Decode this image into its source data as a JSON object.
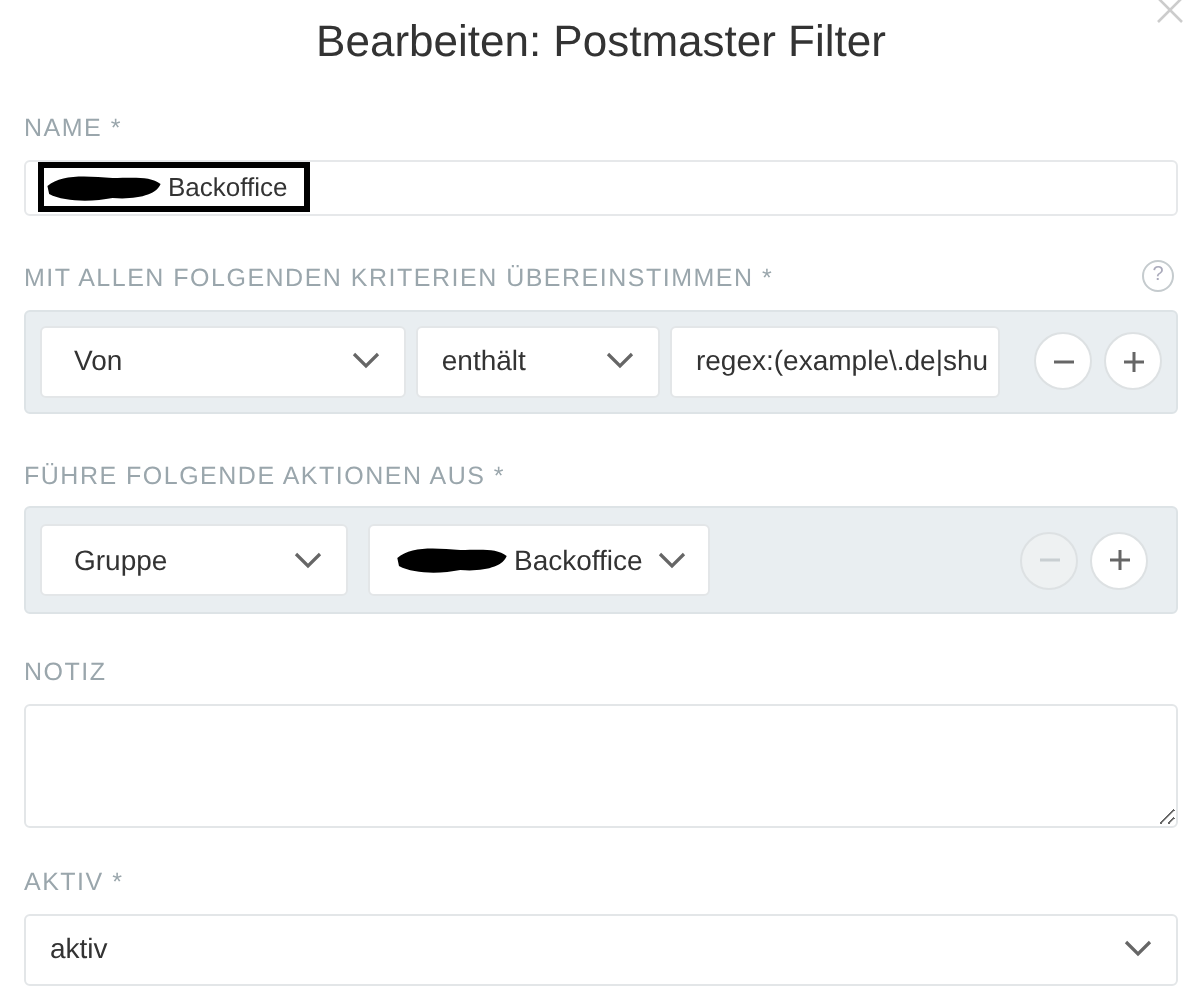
{
  "dialog": {
    "title": "Bearbeiten: Postmaster Filter"
  },
  "name_field": {
    "label": "NAME *",
    "value": "Backoffice",
    "redacted": true,
    "annotated": true
  },
  "criteria": {
    "label": "MIT ALLEN FOLGENDEN KRITERIEN ÜBEREINSTIMMEN *",
    "help": "?",
    "rows": [
      {
        "attribute": "Von",
        "operator": "enthält",
        "value": "regex:(example\\.de|shu",
        "remove_disabled": false
      }
    ]
  },
  "actions": {
    "label": "FÜHRE FOLGENDE AKTIONEN AUS *",
    "rows": [
      {
        "attribute": "Gruppe",
        "value": "Backoffice",
        "redacted": true,
        "remove_disabled": true
      }
    ]
  },
  "note": {
    "label": "NOTIZ"
  },
  "active": {
    "label": "AKTIV *",
    "value": "aktiv"
  }
}
